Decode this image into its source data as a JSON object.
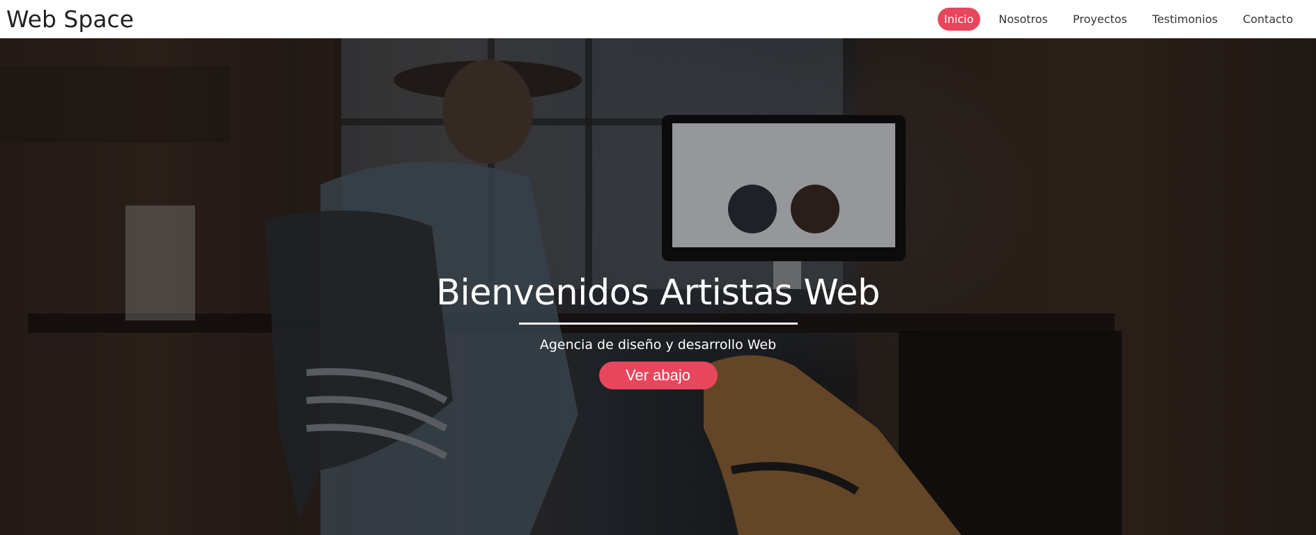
{
  "brand": {
    "title": "Web Space"
  },
  "nav": {
    "items": [
      {
        "label": "Inicio",
        "active": true
      },
      {
        "label": "Nosotros",
        "active": false
      },
      {
        "label": "Proyectos",
        "active": false
      },
      {
        "label": "Testimonios",
        "active": false
      },
      {
        "label": "Contacto",
        "active": false
      }
    ]
  },
  "hero": {
    "title": "Bienvenidos Artistas Web",
    "subtitle": "Agencia de diseño y desarrollo Web",
    "button_label": "Ver abajo"
  },
  "colors": {
    "accent": "#e8465c",
    "navbar_bg": "#ffffff",
    "text_dark": "#222222"
  },
  "icons": {
    "background_image": "office-man-with-dog-photo"
  }
}
